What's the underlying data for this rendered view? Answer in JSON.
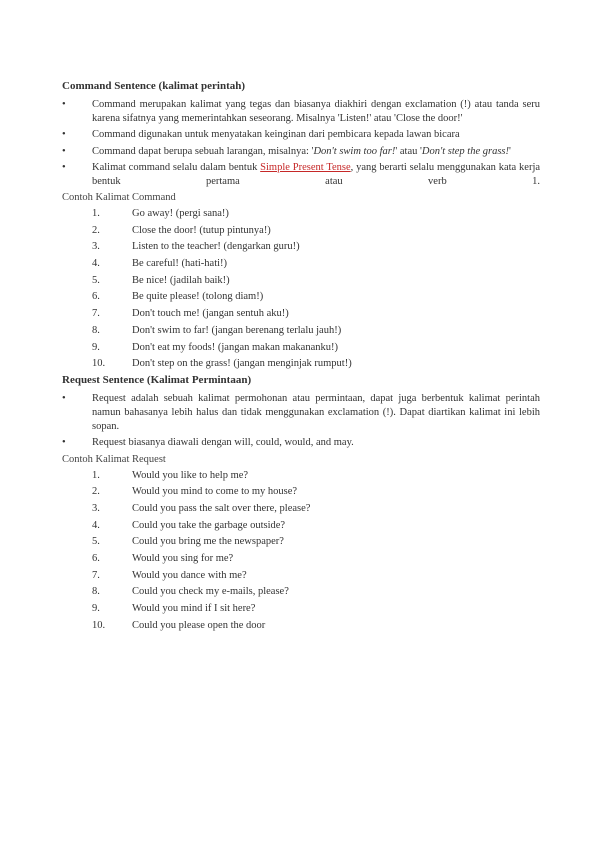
{
  "section1": {
    "title": "Command Sentence (kalimat perintah)",
    "b1a": "Command merupakan kalimat yang tegas dan biasanya diakhiri dengan exclamation (!) atau tanda seru karena sifatnya yang memerintahkan seseorang. Misalnya 'Listen!' atau 'Close the door!'",
    "b2a": "Command digunakan untuk menyatakan keinginan dari pembicara kepada lawan bicara",
    "b3a": "Command dapat berupa sebuah larangan, misalnya: '",
    "b3b": "Don't swim too far!",
    "b3c": "' atau '",
    "b3d": "Don't step the grass!",
    "b3e": "'",
    "b4a": "Kalimat command selalu dalam bentuk ",
    "b4link": "Simple Present Tense",
    "b4b": ", yang berarti selalu menggunakan kata kerja bentuk pertama atau verb 1.",
    "subtitle": "Contoh Kalimat Command",
    "items": [
      "Go away! (pergi sana!)",
      "Close the door! (tutup pintunya!)",
      "Listen to the teacher! (dengarkan guru!)",
      "Be careful! (hati-hati!)",
      "Be nice! (jadilah baik!)",
      "Be quite please! (tolong diam!)",
      "Don't touch me! (jangan sentuh aku!)",
      "Don't swim to far! (jangan berenang terlalu jauh!)",
      "Don't eat my foods! (jangan makan makananku!)",
      "Don't step on the grass! (jangan menginjak rumput!)"
    ]
  },
  "section2": {
    "title": "Request Sentence (Kalimat Permintaan)",
    "b1a": "Request adalah sebuah kalimat permohonan atau permintaan, dapat juga berbentuk kalimat perintah namun bahasanya lebih halus dan tidak menggunakan exclamation (!). Dapat diartikan kalimat ini lebih sopan.",
    "b2a": "Request biasanya diawali dengan will, could, would, and may.",
    "subtitle": "Contoh Kalimat Request",
    "items": [
      "Would you like to help me?",
      "Would you mind to come to my house?",
      "Could you pass the salt over there, please?",
      "Could you take the garbage outside?",
      "Could you bring me the newspaper?",
      "Would you sing for me?",
      "Would you dance with me?",
      "Could you check my e-mails, please?",
      "Would you mind if I sit here?",
      "Could you please open the door"
    ]
  }
}
